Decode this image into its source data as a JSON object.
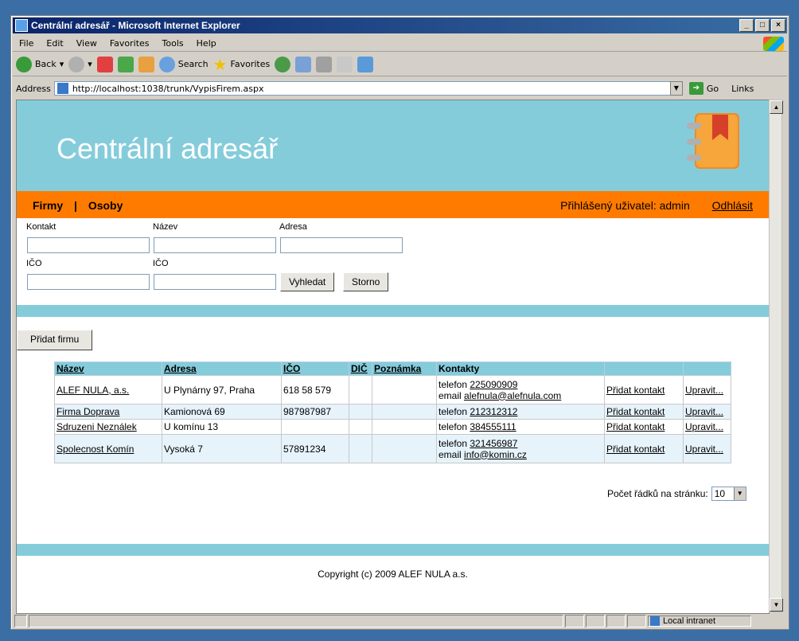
{
  "window": {
    "title": "Centrální adresář - Microsoft Internet Explorer"
  },
  "menu": [
    "File",
    "Edit",
    "View",
    "Favorites",
    "Tools",
    "Help"
  ],
  "toolbar": {
    "back": "Back",
    "search": "Search",
    "favorites": "Favorites"
  },
  "address": {
    "label": "Address",
    "url": "http://localhost:1038/trunk/VypisFirem.aspx",
    "go": "Go",
    "links": "Links"
  },
  "page": {
    "title": "Centrální adresář",
    "nav": {
      "firms": "Firmy",
      "sep": "|",
      "persons": "Osoby",
      "user_label": "Přihlášený uživatel: admin",
      "logout": "Odhlásit"
    },
    "form": {
      "label_kontakt": "Kontakt",
      "label_nazev": "Název",
      "label_adresa": "Adresa",
      "label_ico1": "IČO",
      "label_ico2": "IČO",
      "search_btn": "Vyhledat",
      "cancel_btn": "Storno"
    },
    "add_btn": "Přidat firmu",
    "table": {
      "headers": [
        "Název",
        "Adresa",
        "IČO",
        "DIČ",
        "Poznámka",
        "Kontakty",
        "",
        ""
      ],
      "rows": [
        {
          "name": "ALEF NULA, a.s.",
          "address": "U Plynárny 97, Praha",
          "ico": "618 58 579",
          "dic": "",
          "note": "",
          "c1_label": "telefon",
          "c1_val": "225090909",
          "c2_label": "email",
          "c2_val": "alefnula@alefnula.com",
          "add": "Přidat kontakt",
          "edit": "Upravit..."
        },
        {
          "name": "Firma Doprava",
          "address": "Kamionová 69",
          "ico": "987987987",
          "dic": "",
          "note": "",
          "c1_label": "telefon",
          "c1_val": "212312312",
          "c2_label": "",
          "c2_val": "",
          "add": "Přidat kontakt",
          "edit": "Upravit..."
        },
        {
          "name": "Sdruzeni Neználek",
          "address": "U komínu 13",
          "ico": "",
          "dic": "",
          "note": "",
          "c1_label": "telefon",
          "c1_val": "384555111",
          "c2_label": "",
          "c2_val": "",
          "add": "Přidat kontakt",
          "edit": "Upravit..."
        },
        {
          "name": "Spolecnost Komín",
          "address": "Vysoká 7",
          "ico": "57891234",
          "dic": "",
          "note": "",
          "c1_label": "telefon",
          "c1_val": "321456987",
          "c2_label": "email",
          "c2_val": "info@komin.cz",
          "add": "Přidat kontakt",
          "edit": "Upravit..."
        }
      ]
    },
    "pager": {
      "label": "Počet řádků na stránku:",
      "value": "10"
    },
    "footer": "Copyright (c) 2009 ALEF NULA a.s."
  },
  "status": {
    "zone": "Local intranet"
  }
}
